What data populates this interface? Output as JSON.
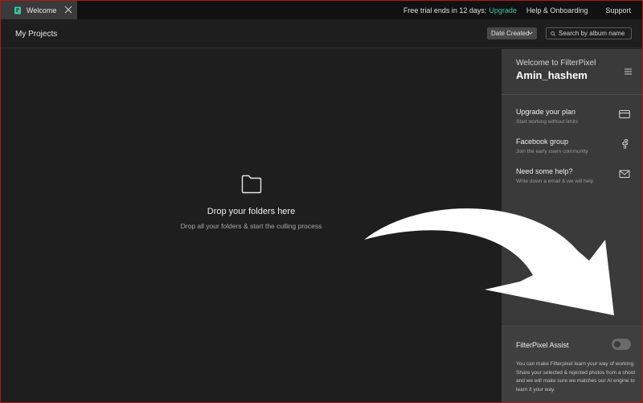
{
  "tab": {
    "label": "Welcome"
  },
  "topbar": {
    "trial_text": "Free trial ends in 12 days:",
    "upgrade_label": "Upgrade",
    "help_label": "Help & Onboarding",
    "support_label": "Support"
  },
  "header": {
    "title": "My Projects",
    "sort_value": "Date Created",
    "search_placeholder": "Search by album name"
  },
  "drop": {
    "title": "Drop your folders here",
    "subtitle": "Drop all your folders & start the culling process"
  },
  "panel": {
    "welcome": "Welcome to FilterPixel",
    "user_name": "Amin_hashem",
    "items": [
      {
        "title": "Upgrade your plan",
        "subtitle": "Start working without limits",
        "icon": "credit-card-icon"
      },
      {
        "title": "Facebook group",
        "subtitle": "Join the early users community",
        "icon": "facebook-icon"
      },
      {
        "title": "Need some help?",
        "subtitle": "Write down a email & we will help",
        "icon": "mail-icon"
      }
    ],
    "assist": {
      "title": "FilterPixel Assist",
      "enabled": false,
      "description": "You can make Filterpixel learn your way of working. Share your selected & rejected photos from a shoot and we will make sure we matches our AI engine to learn it your way."
    }
  },
  "colors": {
    "accent": "#3cc4a4",
    "panel_bg": "#3a3a3a",
    "main_bg": "#1e1e1e",
    "topbar_bg": "#111111"
  }
}
